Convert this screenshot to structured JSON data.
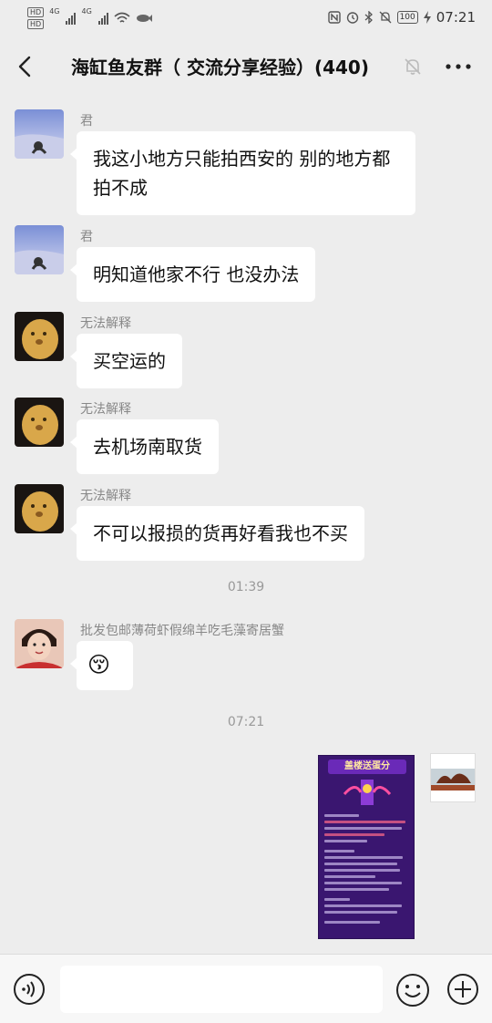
{
  "status_bar": {
    "hd1": "HD",
    "hd2": "HD",
    "net1": "4G",
    "net2": "4G",
    "battery": "100",
    "time": "07:21"
  },
  "header": {
    "title": "海缸鱼友群（ 交流分享经验）(440)",
    "back_icon": "chevron-left-icon",
    "mute_icon": "bell-muted-icon",
    "more_icon": "ellipsis-icon"
  },
  "messages": [
    {
      "sender": "君",
      "text": "我这小地方只能拍西安的  别的地方都拍不成"
    },
    {
      "sender": "君",
      "text": "明知道他家不行    也没办法"
    },
    {
      "sender": "无法解释",
      "text": "买空运的"
    },
    {
      "sender": "无法解释",
      "text": "去机场南取货"
    },
    {
      "sender": "无法解释",
      "text": "不可以报损的货再好看我也不买"
    },
    {
      "sender": "批发包邮薄荷虾假绵羊吃毛藻寄居蟹",
      "emoji": "😚"
    }
  ],
  "timestamps": [
    "01:39",
    "07:21"
  ],
  "poster": {
    "title": "盖楼送蛋分"
  },
  "input_bar": {
    "voice_icon": "voice-icon",
    "emoji_icon": "smiley-icon",
    "plus_icon": "plus-circle-icon"
  }
}
